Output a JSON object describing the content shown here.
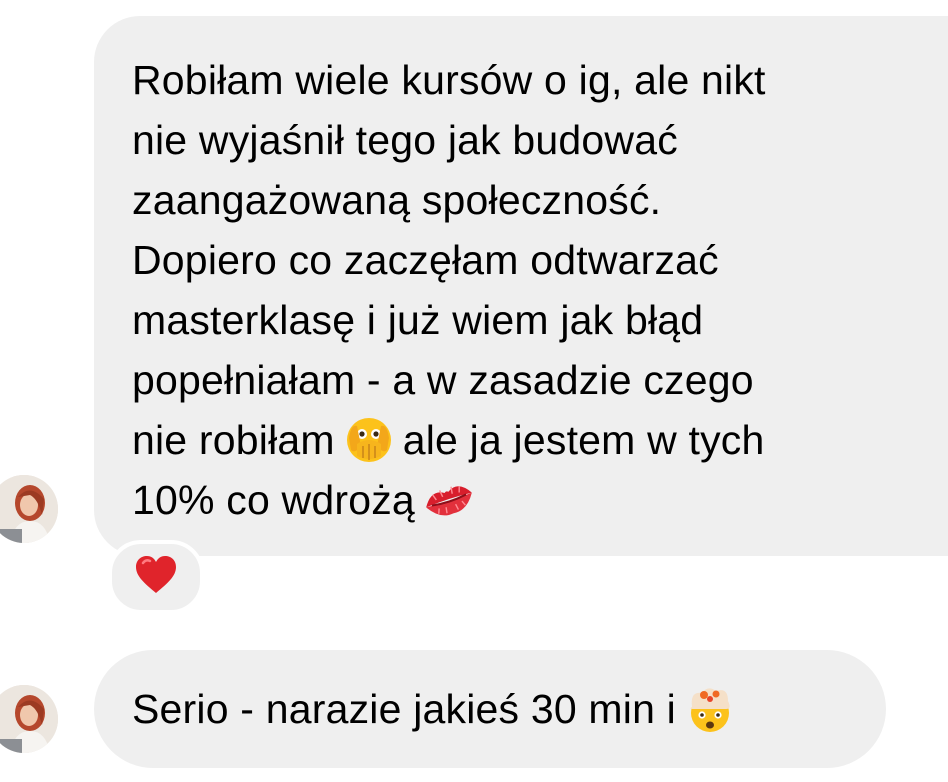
{
  "messages": [
    {
      "segments": [
        "Robiłam wiele kursów o ig, ale nikt\nnie wyjaśnił tego jak budować\nzaangażowaną społeczność.\nDopiero co zaczęłam odtwarzać\nmasterklasę i już wiem jak błąd\npopełniałam - a w zasadzie czego\nnie robiłam",
        "ale ja jestem w tych\n10% co wdrożą"
      ],
      "emojis": [
        "face-with-open-eyes-and-hand-over-mouth-emoji",
        "kiss-mark-emoji"
      ],
      "reaction": "red-heart-emoji"
    },
    {
      "segments": [
        "Serio - narazie jakieś 30 min i"
      ],
      "emojis": [
        "exploding-head-emoji"
      ]
    }
  ],
  "colors": {
    "bubble": "#efefef",
    "text": "#000000",
    "heart": "#e0242b",
    "background": "#ffffff"
  }
}
